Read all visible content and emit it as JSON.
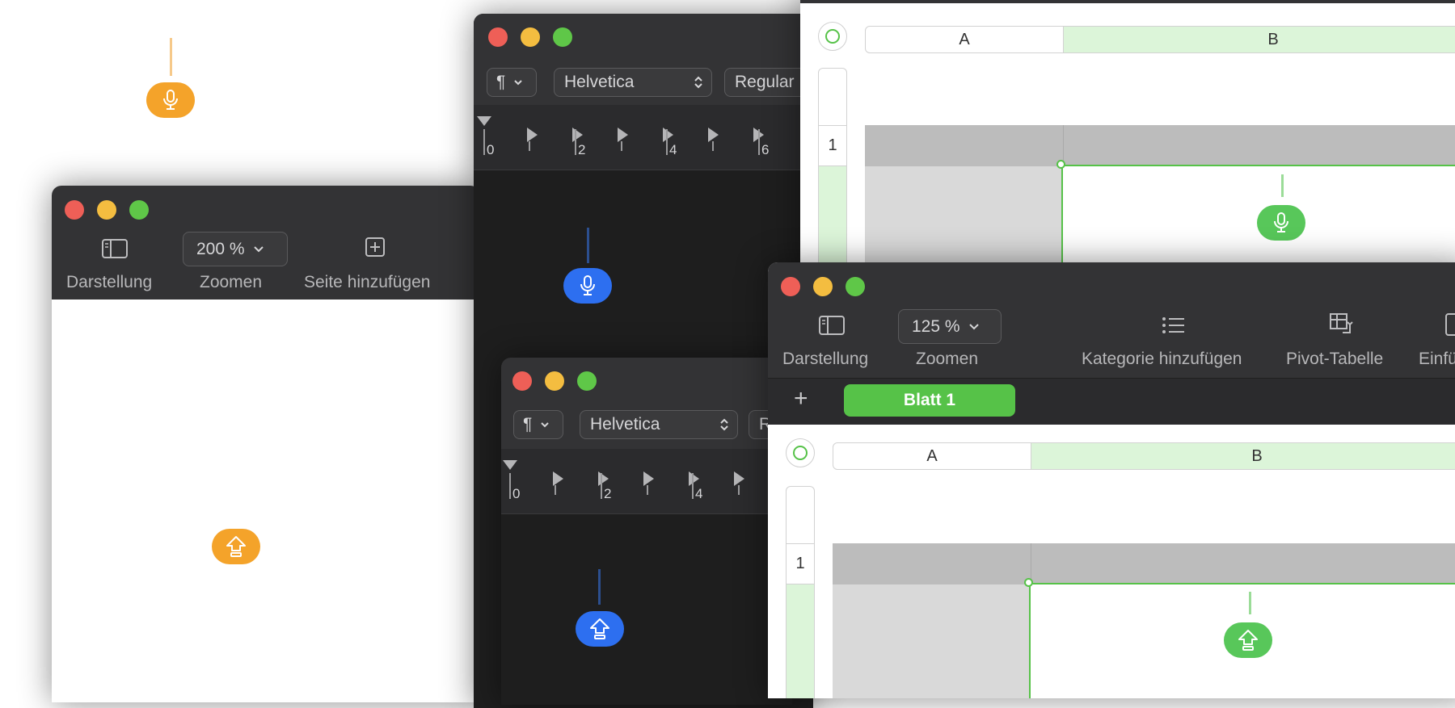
{
  "pages_window": {
    "toolbar": {
      "view_label": "Darstellung",
      "zoom_value": "200 %",
      "zoom_label": "Zoomen",
      "add_page_label": "Seite hinzufügen"
    }
  },
  "textedit_window_1": {
    "paragraph_symbol": "¶",
    "font_family": "Helvetica",
    "font_style": "Regular",
    "ruler_numbers": [
      "0",
      "2",
      "4",
      "6"
    ]
  },
  "textedit_window_2": {
    "paragraph_symbol": "¶",
    "font_family": "Helvetica",
    "font_style_partial": "R",
    "ruler_numbers": [
      "0",
      "2",
      "4"
    ]
  },
  "numbers_window_back": {
    "column_headers": [
      "A",
      "B"
    ],
    "row_numbers": [
      "1"
    ]
  },
  "numbers_window_front": {
    "toolbar": {
      "view_label": "Darstellung",
      "zoom_value": "125 %",
      "zoom_label": "Zoomen",
      "add_category_label": "Kategorie hinzufügen",
      "pivot_label": "Pivot-Tabelle",
      "insert_label_partial": "Einfü"
    },
    "add_sheet_symbol": "+",
    "sheet_tab": "Blatt 1",
    "column_headers": [
      "A",
      "B"
    ],
    "row_numbers": [
      "1"
    ]
  },
  "colors": {
    "orange_badge": "#f4a32a",
    "blue_badge": "#2d6ff0",
    "green_badge": "#58c75a",
    "numbers_green": "#56c248"
  },
  "indicator_icons": [
    "microphone-icon",
    "shift-arrow-icon"
  ]
}
